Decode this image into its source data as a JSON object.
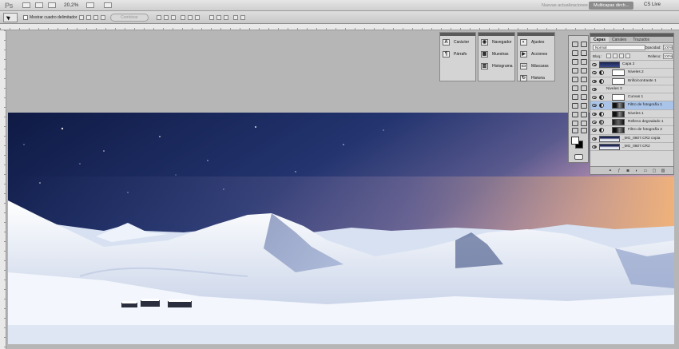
{
  "menubar": {
    "zoom": "20,2%",
    "workspace_inactive": "Nuevas actualizaciones",
    "workspace_active": "Multicapas dirch...",
    "cs_live": "CS Live"
  },
  "options": {
    "show_bounds_label": "Mostrar cuadro delimitador",
    "combine_label": "Combinar"
  },
  "panels": {
    "col1": [
      {
        "icon": "A",
        "label": "Carácter"
      },
      {
        "icon": "¶",
        "label": "Párrafo"
      }
    ],
    "col2": [
      {
        "icon": "◉",
        "label": "Navegador"
      },
      {
        "icon": "▦",
        "label": "Muestras"
      },
      {
        "icon": "▥",
        "label": "Histograma"
      }
    ],
    "col3": [
      {
        "icon": "◐",
        "label": "Ajustes"
      },
      {
        "icon": "▶",
        "label": "Acciones"
      },
      {
        "icon": "▭",
        "label": "Máscaras"
      },
      {
        "icon": "↻",
        "label": "Historia"
      }
    ]
  },
  "layers": {
    "tabs": [
      "Capas",
      "Canales",
      "Trazados"
    ],
    "blend_mode": "Normal",
    "opacity_label": "Opacidad:",
    "opacity_value": "100%",
    "lock_label": "Bloq.:",
    "fill_label": "Relleno:",
    "fill_value": "100%",
    "items": [
      {
        "name": "Capa 2",
        "kind": "pixel"
      },
      {
        "name": "Niveles 2",
        "kind": "adjust"
      },
      {
        "name": "Brillo/contraste 1",
        "kind": "adjust"
      },
      {
        "name": "Niveles 3",
        "kind": "plain"
      },
      {
        "name": "Curvas 1",
        "kind": "adjust"
      },
      {
        "name": "Filtro de fotografía 1",
        "kind": "adjust-dark",
        "selected": true
      },
      {
        "name": "Niveles 1",
        "kind": "adjust-dark"
      },
      {
        "name": "Relleno degradado 1",
        "kind": "gradient"
      },
      {
        "name": "Filtro de fotografía 2",
        "kind": "adjust-dark"
      },
      {
        "name": "_MG_0607.CR2 copia",
        "kind": "photo"
      },
      {
        "name": "_MG_0607.CR2",
        "kind": "photo"
      }
    ],
    "footer_icons": [
      "link-icon",
      "fx-icon",
      "mask-icon",
      "adjustment-icon",
      "folder-icon",
      "new-layer-icon",
      "trash-icon"
    ]
  },
  "colors": {
    "sky_top": "#111a3d",
    "sky_mid": "#2a3a78",
    "sunset": "#e8b48c",
    "snow": "#e9eef8"
  }
}
